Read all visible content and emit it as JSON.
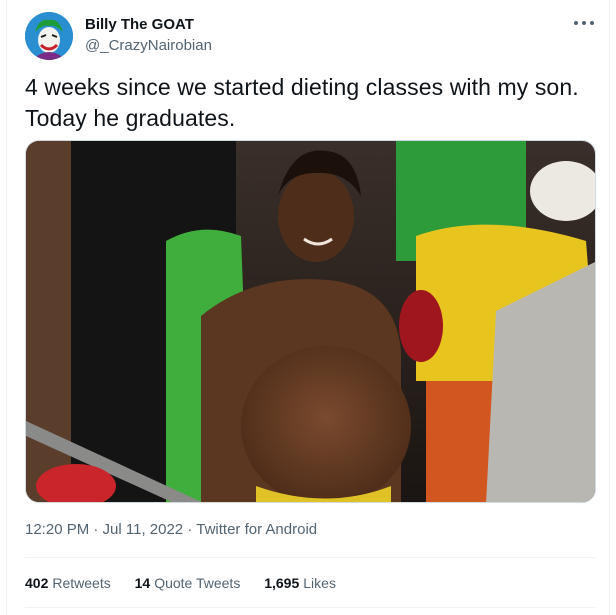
{
  "tweet": {
    "author": {
      "display_name": "Billy The GOAT",
      "handle": "@_CrazyNairobian",
      "avatar_icon": "joker-avatar-icon"
    },
    "more_icon": "more-options-icon",
    "text_lines": [
      "4 weeks since we started dieting classes with my son.",
      "Today he graduates."
    ],
    "media_alt": "",
    "timestamp": "12:20 PM · Jul 11, 2022",
    "separator": "·",
    "source": "Twitter for Android",
    "stats": {
      "retweets": {
        "count": "402",
        "label": "Retweets"
      },
      "quote_tweets": {
        "count": "14",
        "label": "Quote Tweets"
      },
      "likes": {
        "count": "1,695",
        "label": "Likes"
      }
    }
  },
  "colors": {
    "text": "#0f1419",
    "secondary": "#536471",
    "border": "#eff3f4",
    "avatar_bg": "#1f7fbf"
  }
}
